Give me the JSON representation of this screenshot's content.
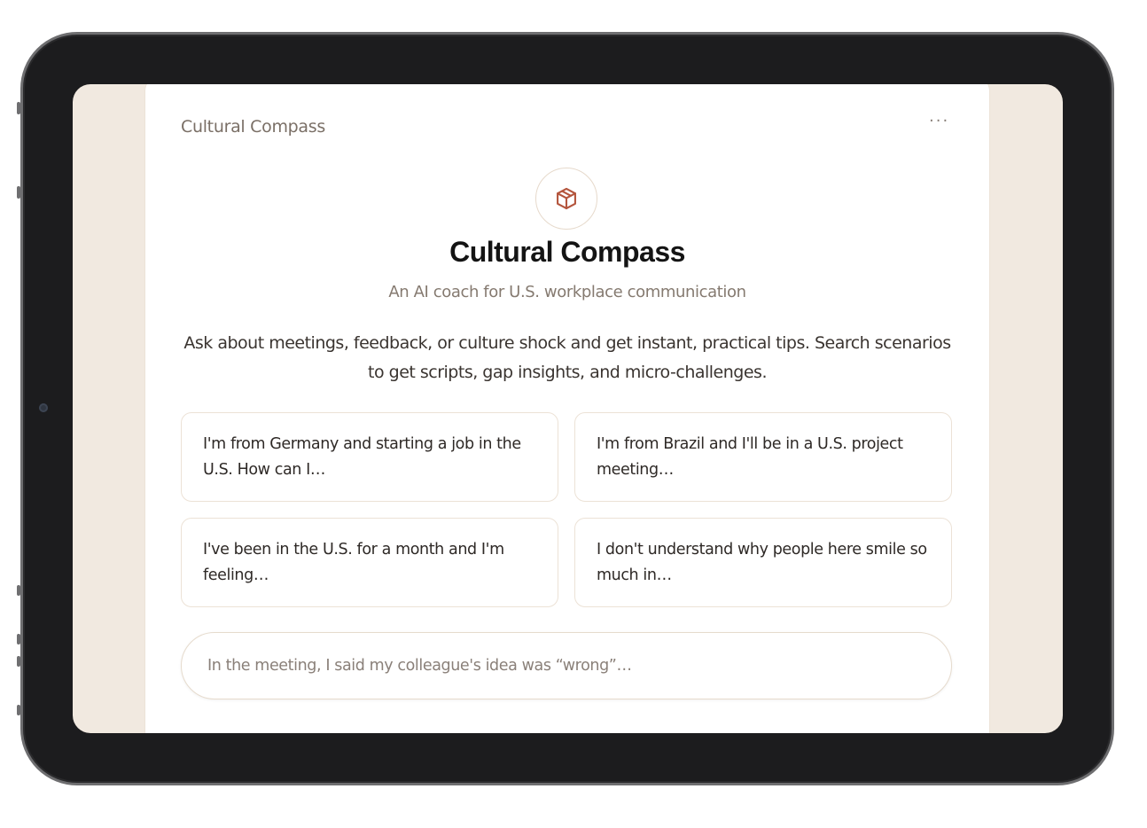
{
  "app": {
    "header_label": "Cultural Compass",
    "menu_icon": "more-horizontal-icon",
    "menu_glyph": "···",
    "logo_icon": "cube-icon"
  },
  "hero": {
    "title": "Cultural Compass",
    "subtitle": "An AI coach for U.S. workplace communication",
    "description": "Ask about meetings, feedback, or culture shock and get instant, practical tips. Search scenarios to get scripts, gap insights, and micro-challenges."
  },
  "suggestions": [
    {
      "text": "I'm from Germany and starting a job in the U.S. How can I…"
    },
    {
      "text": "I'm from Brazil and I'll be in a U.S. project meeting…"
    },
    {
      "text": "I've been in the U.S. for a month and I'm feeling…"
    },
    {
      "text": "I don't understand why people here smile so much in…"
    }
  ],
  "composer": {
    "placeholder": "In the meeting, I said my colleague's idea was “wrong”…"
  },
  "colors": {
    "accent": "#b4553d",
    "background": "#f1e9e0",
    "device_bezel": "#1c1c1e"
  }
}
